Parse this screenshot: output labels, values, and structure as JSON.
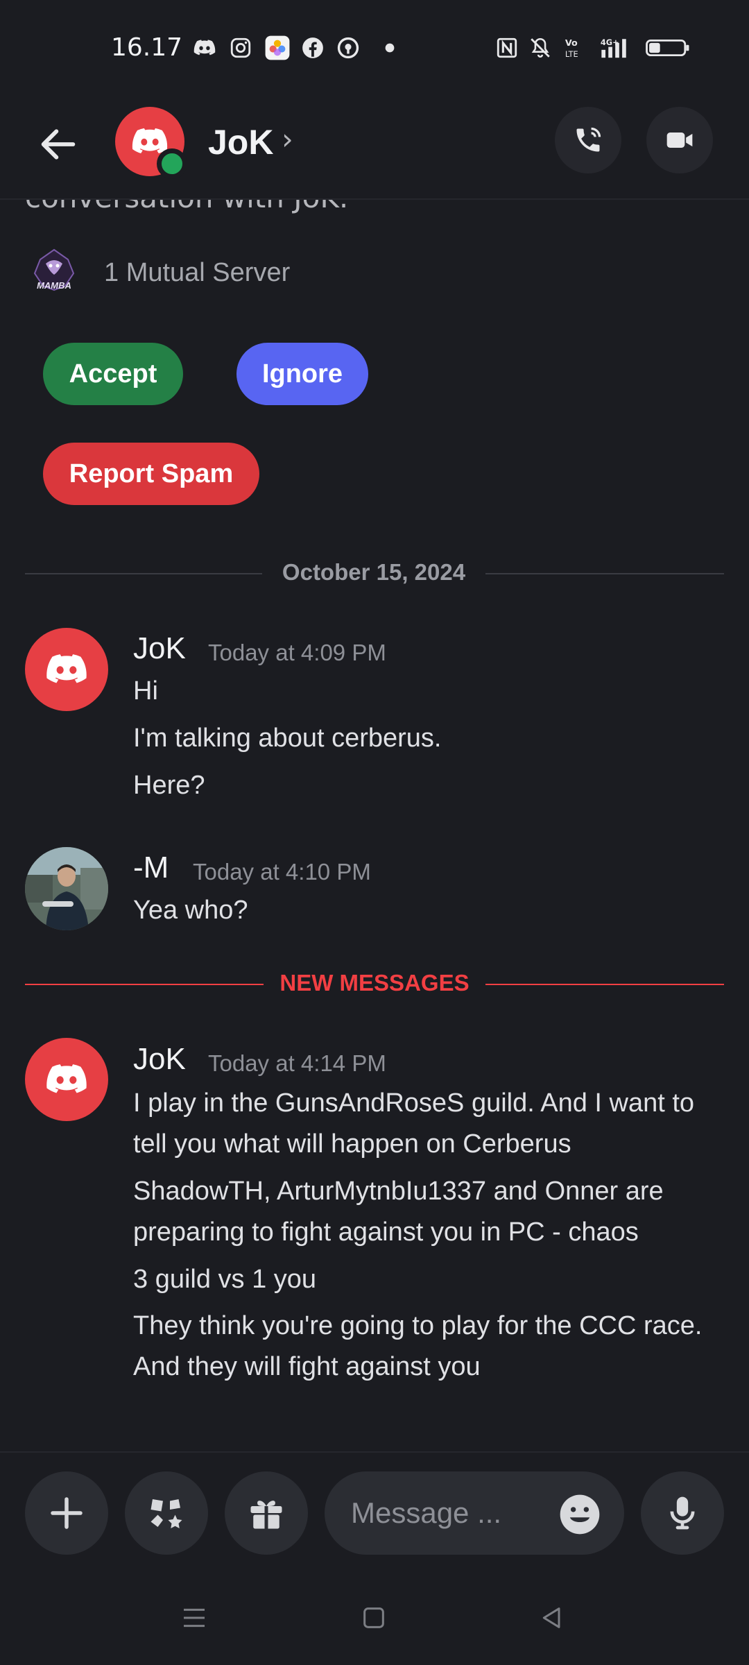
{
  "status_bar": {
    "time": "16.17",
    "icons": [
      "discord-icon",
      "instagram-icon",
      "photos-icon",
      "facebook-icon",
      "messenger-icon",
      "dot-icon",
      "nfc-icon",
      "mute-icon",
      "volte-icon",
      "signal-4g-icon",
      "battery-icon"
    ],
    "network_label": "4G+"
  },
  "header": {
    "back_icon": "back-arrow-icon",
    "username": "JoK",
    "chevron": "›",
    "call_icon": "phone-icon",
    "video_icon": "video-camera-icon"
  },
  "intro": {
    "partial_text": "conversation with JoK.",
    "mutual_server_logo": "MAMBA",
    "mutual_servers": "1 Mutual Server"
  },
  "request_actions": {
    "accept": "Accept",
    "ignore": "Ignore",
    "report_spam": "Report Spam"
  },
  "date_divider": "October 15, 2024",
  "new_messages_divider": "NEW MESSAGES",
  "messages": [
    {
      "author": "JoK",
      "timestamp": "Today at 4:09 PM",
      "lines": [
        "Hi",
        "I'm talking about cerberus.",
        "Here?"
      ]
    },
    {
      "author": "-M",
      "timestamp": "Today at 4:10 PM",
      "lines": [
        "Yea who?"
      ]
    },
    {
      "author": "JoK",
      "timestamp": "Today at 4:14 PM",
      "lines": [
        "I play in the GunsAndRoseS guild. And I want to tell you what will happen on Cerberus",
        "ShadowTH, ArturMytnbIu1337 and Onner are preparing to fight against you in PC - chaos",
        "3 guild vs 1 you",
        "They think you're going to play for the CCC race. And they will fight against you"
      ]
    }
  ],
  "composer": {
    "placeholder": "Message ...",
    "icons": [
      "plus-icon",
      "apps-icon",
      "gift-icon",
      "emoji-icon",
      "microphone-icon"
    ]
  },
  "nav_bar": {
    "icons": [
      "menu-icon",
      "home-icon",
      "back-icon"
    ]
  },
  "colors": {
    "background": "#1b1c21",
    "accept": "#248046",
    "ignore": "#5865f2",
    "report": "#da373c",
    "new_messages": "#f23f43",
    "discord_red": "#e63f44",
    "online": "#23a55a"
  }
}
